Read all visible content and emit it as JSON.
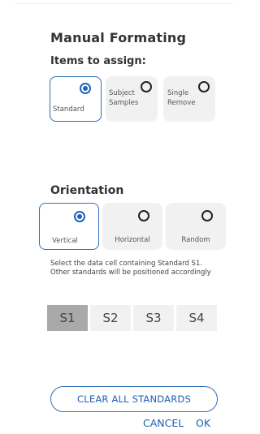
{
  "dialog": {
    "title": "Manual Formating",
    "items_label": "Items to assign:"
  },
  "items_options": [
    {
      "label": "Standard",
      "selected": true
    },
    {
      "label": "Subject\nSamples",
      "selected": false
    },
    {
      "label": "Single\nRemove",
      "selected": false
    }
  ],
  "orientation": {
    "title": "Orientation",
    "options": [
      {
        "label": "Vertical",
        "selected": true
      },
      {
        "label": "Horizontal",
        "selected": false
      },
      {
        "label": "Random",
        "selected": false
      }
    ]
  },
  "help_text": "Select the data cell containing Standard S1. Other standards will be positioned accordingly",
  "standards": [
    {
      "label": "S1",
      "active": true
    },
    {
      "label": "S2",
      "active": false
    },
    {
      "label": "S3",
      "active": false
    },
    {
      "label": "S4",
      "active": false
    }
  ],
  "buttons": {
    "clear": "CLEAR ALL STANDARDS",
    "cancel": "CANCEL",
    "ok": "OK"
  },
  "colors": {
    "accent": "#1f64b8",
    "card_bg": "#f1f1f1",
    "active_segment": "#a9a9a9"
  }
}
